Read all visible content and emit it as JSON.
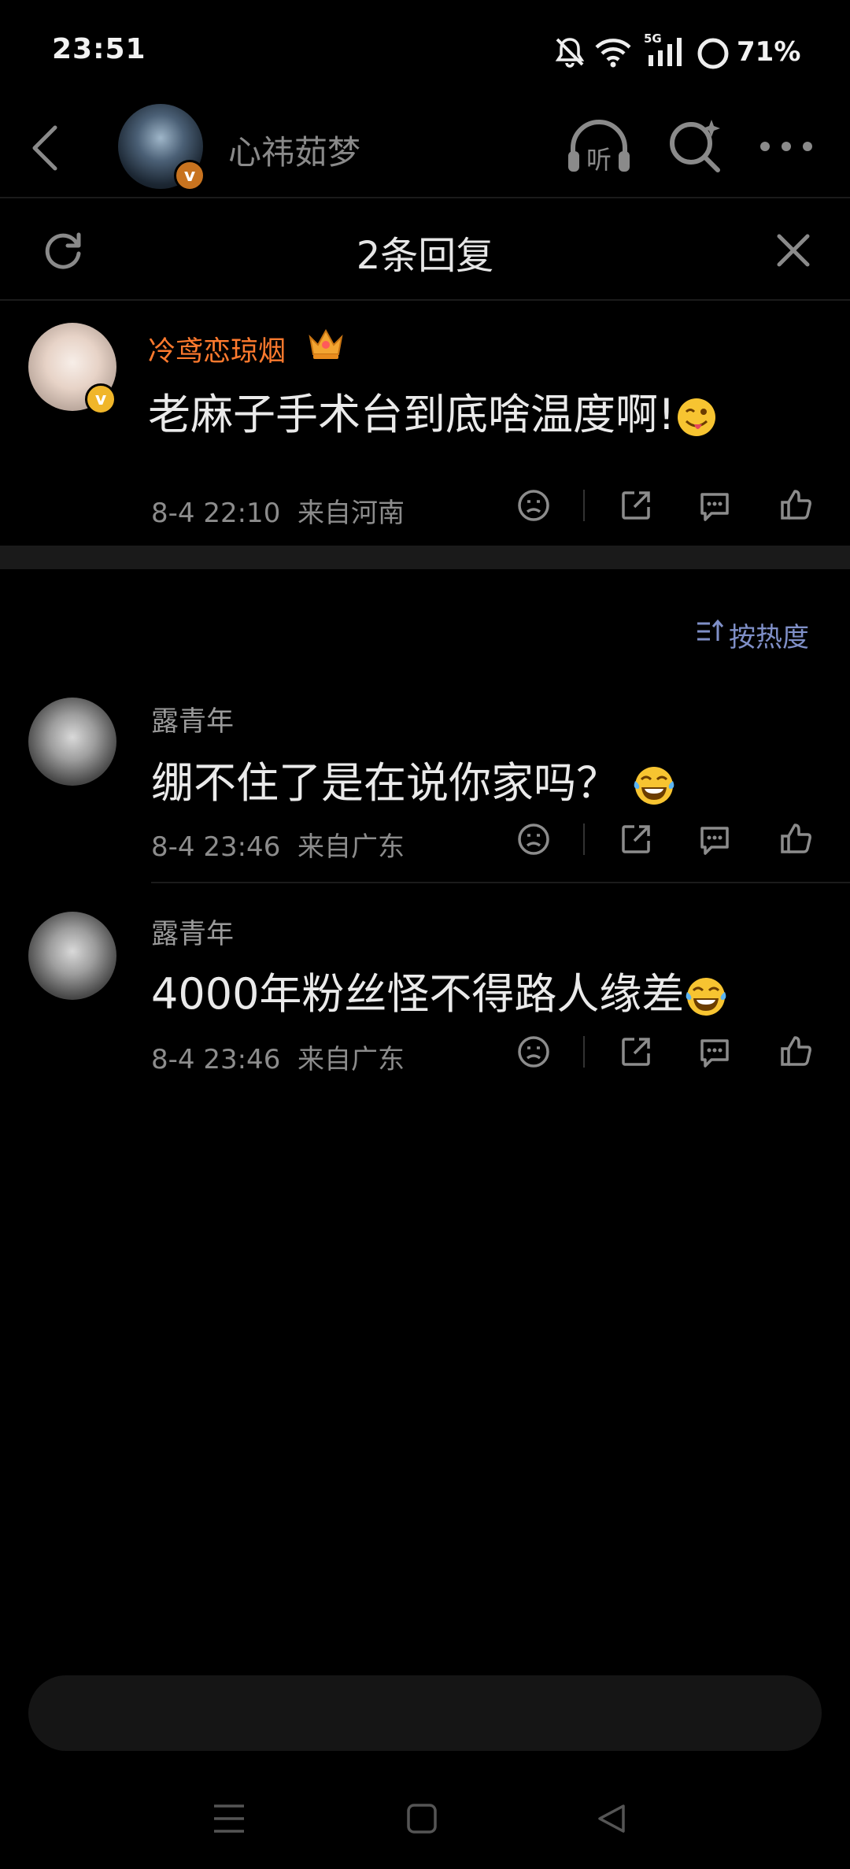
{
  "status_bar": {
    "time": "23:51",
    "battery": "71%"
  },
  "nav": {
    "title": "心祎茹梦",
    "listen_icon": "headphones-listen-icon",
    "search_icon": "search-sparkle-icon",
    "more_icon": "more-icon"
  },
  "reply_header": {
    "title": "2条回复"
  },
  "original": {
    "author": "冷鸢恋琼烟",
    "text": "老麻子手术台到底啥温度啊!",
    "time": "8-4 22:10",
    "location": "来自河南"
  },
  "sort": {
    "label": "按热度"
  },
  "replies": [
    {
      "author": "露青年",
      "text": "绷不住了是在说你家吗？",
      "time": "8-4 23:46",
      "location": "来自广东"
    },
    {
      "author": "露青年",
      "text": "4000年粉丝怪不得路人缘差",
      "time": "8-4 23:46",
      "location": "来自广东"
    }
  ],
  "colors": {
    "background": "#000000",
    "author_highlight": "#ff7a2e",
    "sort_accent": "#7f8fc7",
    "verified_gold": "#f0b62a",
    "verified_orange": "#c8731f"
  }
}
